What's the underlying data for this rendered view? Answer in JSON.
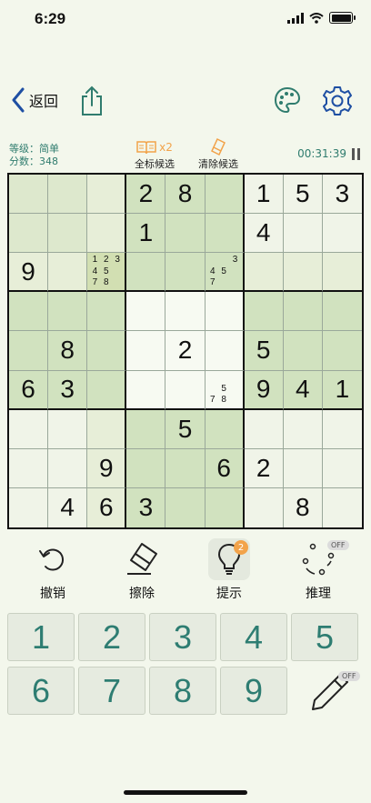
{
  "status_bar": {
    "time": "6:29"
  },
  "nav": {
    "back_label": "返回"
  },
  "info": {
    "level": "等级：简单",
    "score": "分数：348",
    "mark_candidates_label": "全标候选",
    "mark_candidates_count": "x2",
    "clear_candidates_label": "清除候选",
    "timer": "00:31:39"
  },
  "board": {
    "values": [
      [
        "",
        "",
        "",
        "2",
        "8",
        "",
        "1",
        "5",
        "3"
      ],
      [
        "",
        "",
        "",
        "1",
        "",
        "",
        "4",
        "",
        ""
      ],
      [
        "9",
        "",
        "",
        "",
        "",
        "",
        "",
        "",
        ""
      ],
      [
        "",
        "",
        "",
        "",
        "",
        "",
        "",
        "",
        ""
      ],
      [
        "",
        "8",
        "",
        "",
        "2",
        "",
        "5",
        "",
        ""
      ],
      [
        "6",
        "3",
        "",
        "",
        "",
        "",
        "9",
        "4",
        "1"
      ],
      [
        "",
        "",
        "",
        "",
        "5",
        "",
        "",
        "",
        ""
      ],
      [
        "",
        "",
        "9",
        "",
        "",
        "6",
        "2",
        "",
        ""
      ],
      [
        "",
        "4",
        "6",
        "3",
        "",
        "",
        "",
        "8",
        ""
      ]
    ],
    "notes": {
      "2-2": [
        "1",
        "2",
        "3",
        "4",
        "5",
        "",
        "7",
        "8",
        ""
      ],
      "2-5": [
        "",
        "",
        "3",
        "4",
        "5",
        "",
        "7",
        "",
        ""
      ],
      "5-5": [
        "",
        "",
        "",
        "",
        "5",
        "",
        "7",
        "8",
        ""
      ]
    },
    "colors": {
      "light": "#f0f4e8",
      "tint": "#e7eed8",
      "box": "#dde8cd",
      "dark": "#d1e2bf",
      "selected": "#d2dfb2"
    }
  },
  "tools": {
    "undo_label": "撤销",
    "erase_label": "擦除",
    "hint_label": "提示",
    "hint_count": "2",
    "reason_label": "推理",
    "reason_state": "OFF"
  },
  "keypad": {
    "numbers": [
      "1",
      "2",
      "3",
      "4",
      "5",
      "6",
      "7",
      "8",
      "9"
    ],
    "pencil_state": "OFF"
  }
}
